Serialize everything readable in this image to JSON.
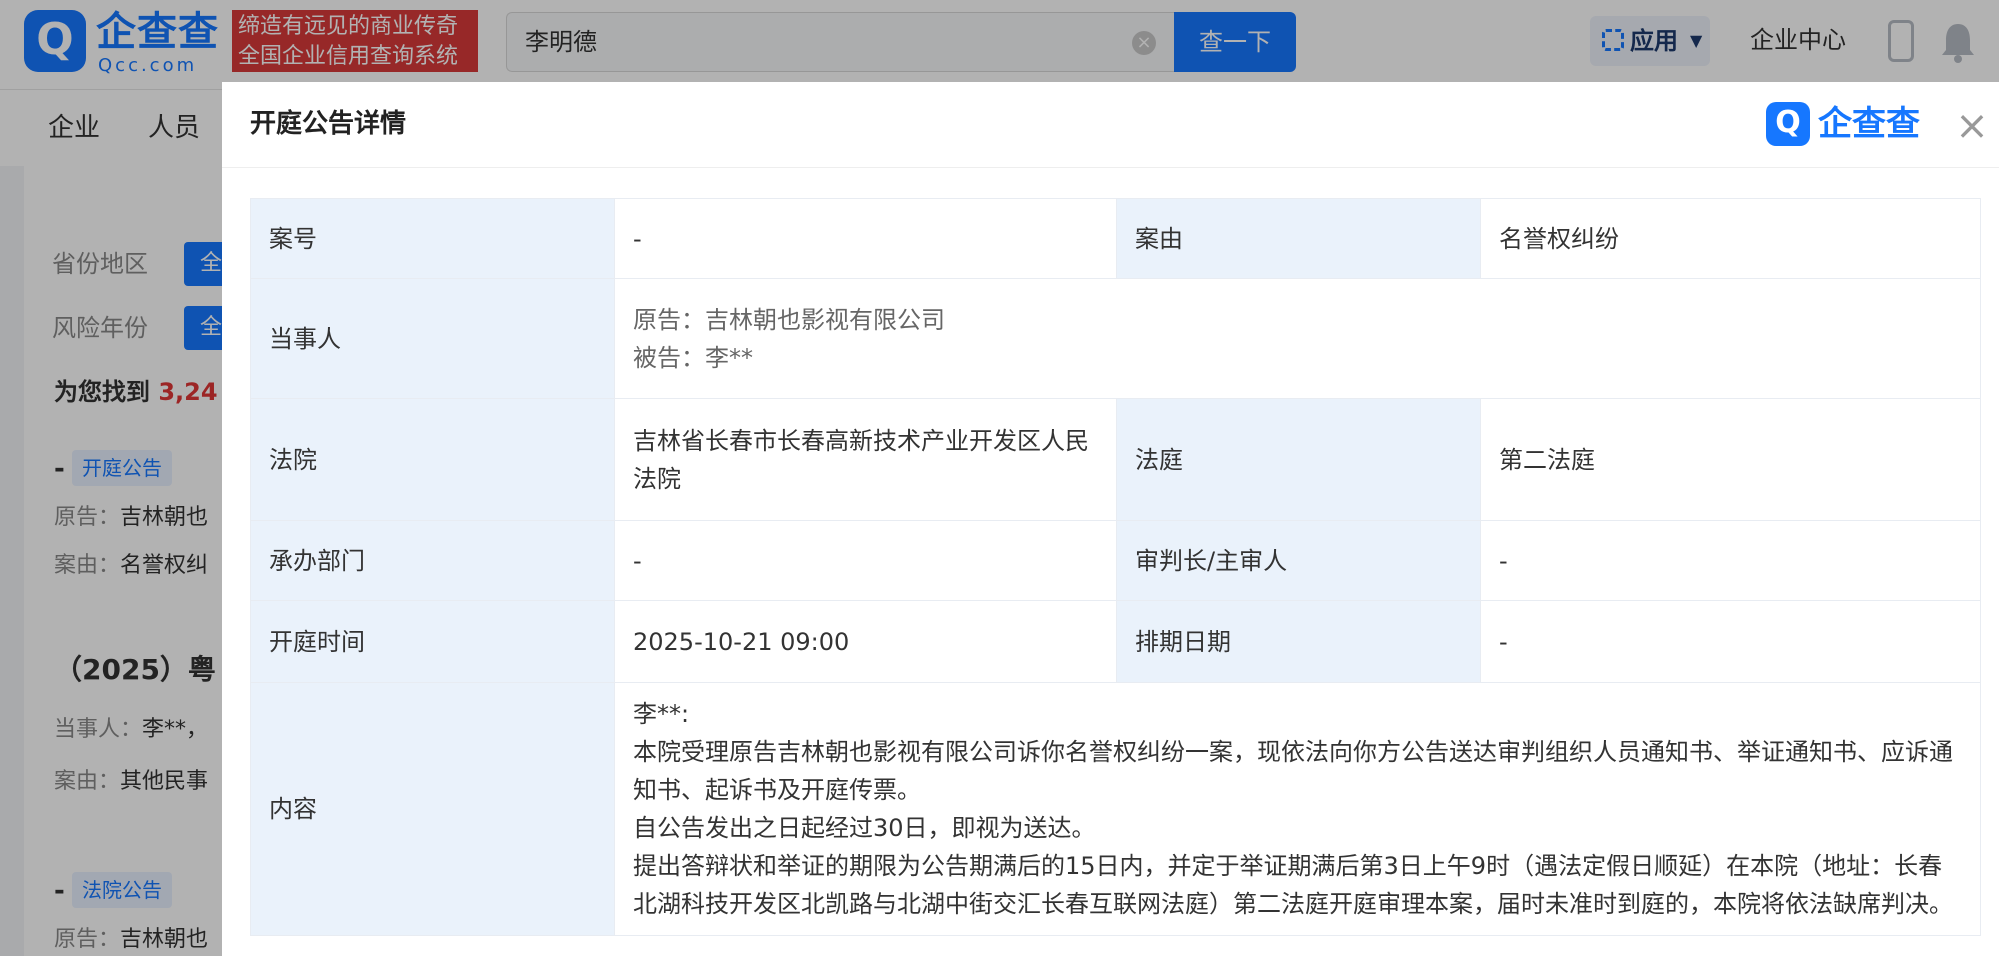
{
  "header": {
    "logo_mark": "Q",
    "logo_text": "企查查",
    "logo_sub": "Qcc.com",
    "slogan_line1": "缔造有远见的商业传奇",
    "slogan_line2": "全国企业信用查询系统",
    "search_value": "李明德",
    "search_button": "查一下",
    "apps_label": "应用",
    "enterprise_center": "企业中心"
  },
  "background": {
    "nav": [
      "企业",
      "人员"
    ],
    "filters": [
      {
        "label": "省份地区",
        "button": "全"
      },
      {
        "label": "风险年份",
        "button": "全"
      }
    ],
    "result_prefix": "为您找到",
    "result_count": "3,24",
    "results": [
      {
        "dash": "-",
        "tag": "开庭公告",
        "line1_label": "原告：",
        "line1_value": "吉林朝也",
        "line2_label": "案由：",
        "line2_value": "名誉权纠"
      },
      {
        "heading": "（2025）粤",
        "line1_label": "当事人：",
        "line1_value": "李**，",
        "line2_label": "案由：",
        "line2_value": "其他民事"
      },
      {
        "dash": "-",
        "tag": "法院公告",
        "line1_label": "原告：",
        "line1_value": "吉林朝也"
      }
    ]
  },
  "modal": {
    "title": "开庭公告详情",
    "logo_mark": "Q",
    "logo_text": "企查查",
    "close": "×",
    "rows": {
      "case_no_label": "案号",
      "case_no": "-",
      "cause_label": "案由",
      "cause": "名誉权纠纷",
      "party_label": "当事人",
      "plaintiff": "原告：吉林朝也影视有限公司",
      "defendant": "被告：李**",
      "court_label": "法院",
      "court": "吉林省长春市长春高新技术产业开发区人民法院",
      "tribunal_label": "法庭",
      "tribunal": "第二法庭",
      "dept_label": "承办部门",
      "dept": "-",
      "judge_label": "审判长/主审人",
      "judge": "-",
      "hearing_time_label": "开庭时间",
      "hearing_time": "2025-10-21 09:00",
      "schedule_label": "排期日期",
      "schedule": "-",
      "content_label": "内容",
      "content_lines": [
        "李**:",
        "本院受理原告吉林朝也影视有限公司诉你名誉权纠纷一案，现依法向你方公告送达审判组织人员通知书、举证通知书、应诉通知书、起诉书及开庭传票。",
        "自公告发出之日起经过30日，即视为送达。",
        "提出答辩状和举证的期限为公告期满后的15日内，并定于举证期满后第3日上午9时（遇法定假日顺延）在本院（地址：长春北湖科技开发区北凯路与北湖中街交汇长春互联网法庭）第二法庭开庭审理本案，届时未准时到庭的，本院将依法缺席判决。"
      ]
    }
  }
}
